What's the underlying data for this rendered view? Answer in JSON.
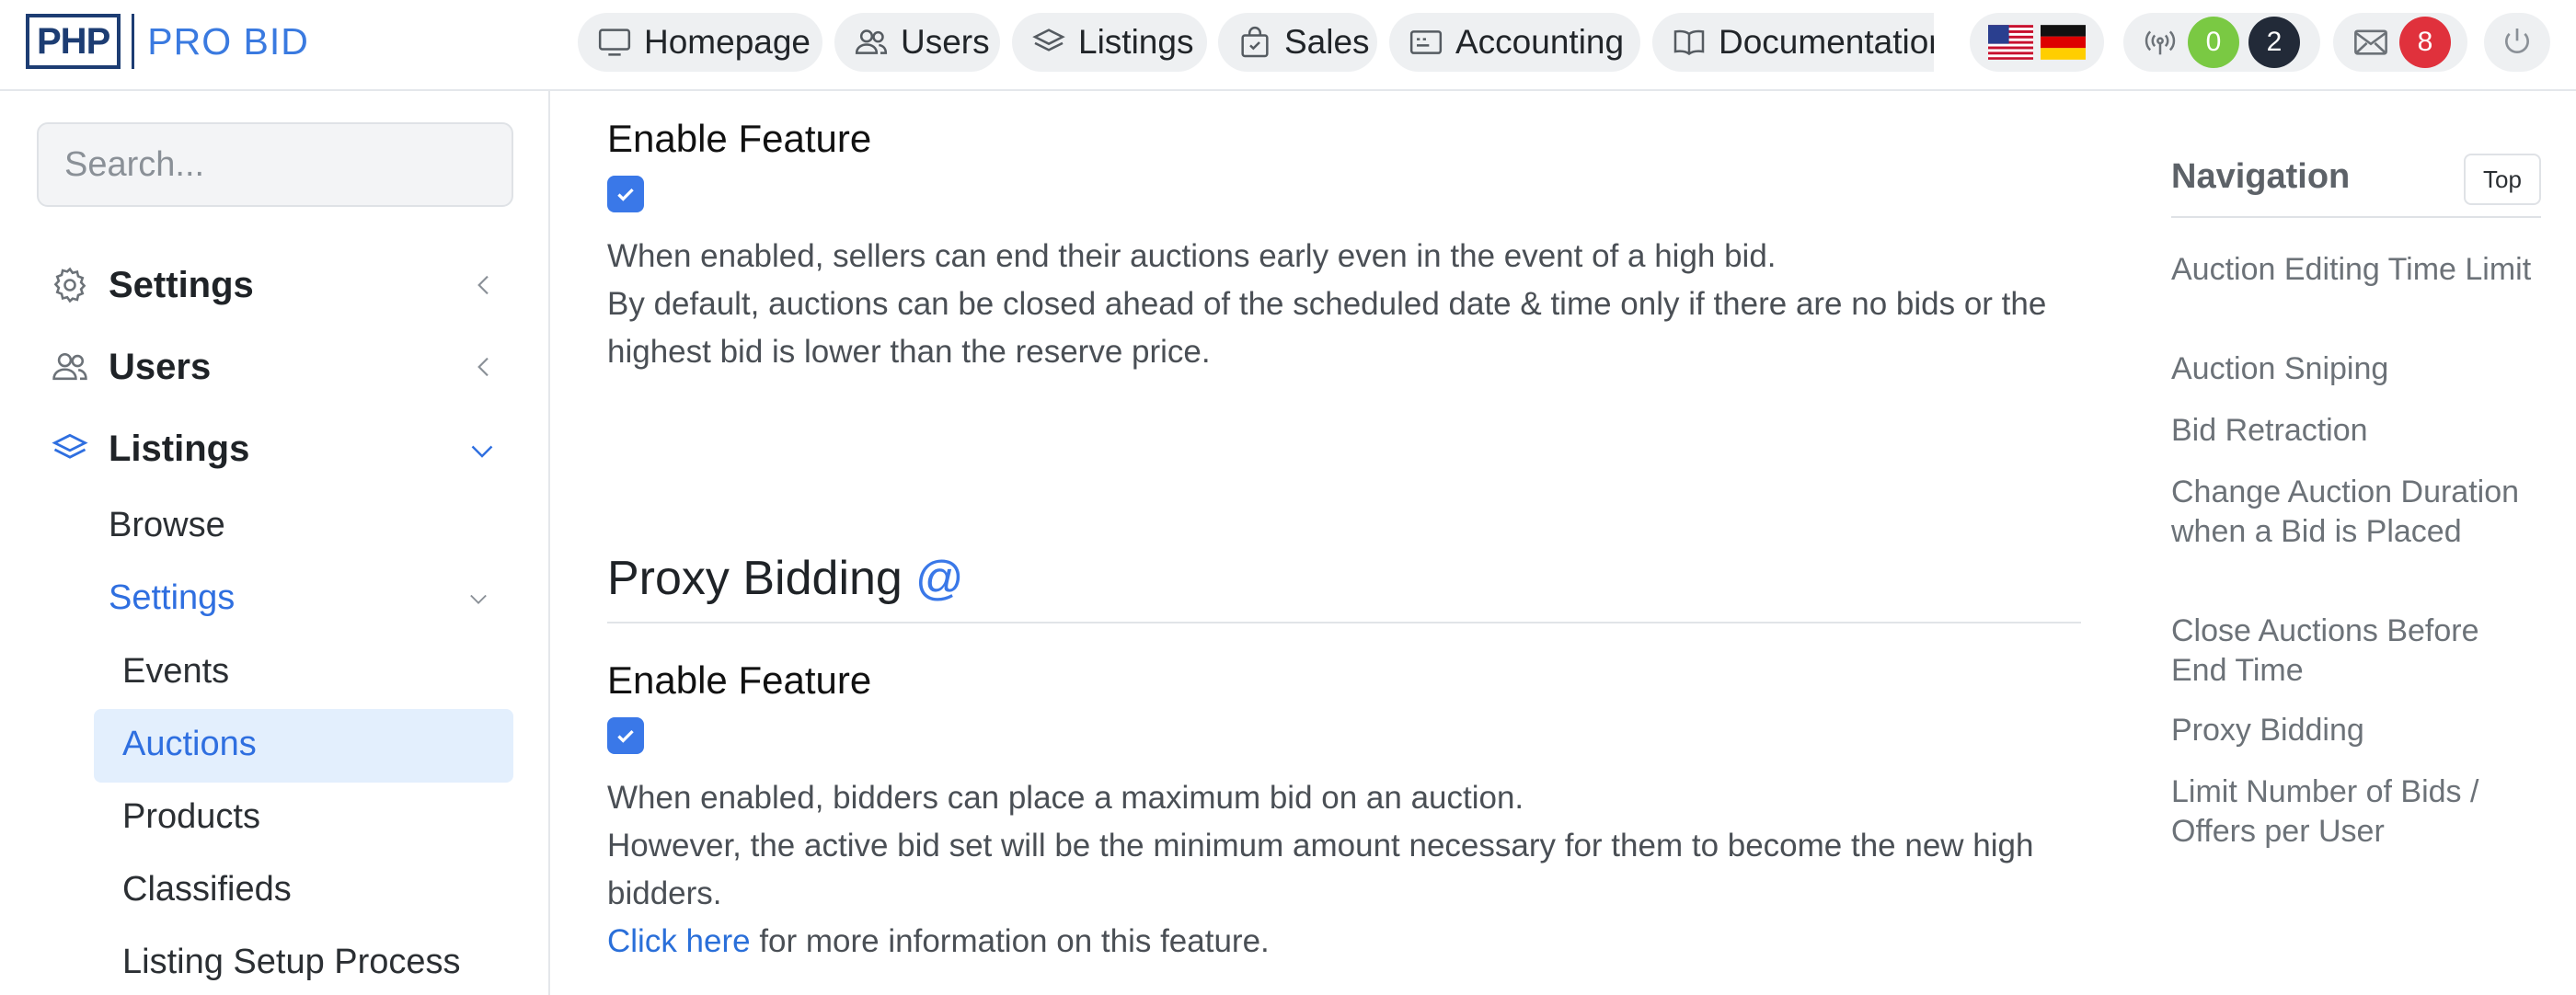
{
  "brand": {
    "logo_left": "PHP",
    "logo_right": "PRO BID"
  },
  "topnav": {
    "items": [
      {
        "label": "Homepage",
        "icon": "monitor-icon"
      },
      {
        "label": "Users",
        "icon": "users-icon"
      },
      {
        "label": "Listings",
        "icon": "layers-icon"
      },
      {
        "label": "Sales",
        "icon": "shopping-bag-icon"
      },
      {
        "label": "Accounting",
        "icon": "card-icon"
      },
      {
        "label": "Documentation",
        "icon": "book-icon"
      }
    ],
    "flags": [
      "us-flag-icon",
      "de-flag-icon"
    ],
    "notifications": {
      "green_count": "0",
      "dark_count": "2",
      "icon": "broadcast-icon"
    },
    "messages": {
      "count": "8",
      "icon": "envelope-icon"
    },
    "power_icon": "power-icon"
  },
  "sidebar": {
    "search_placeholder": "Search...",
    "items": [
      {
        "label": "Settings",
        "icon": "gear-icon",
        "expanded": false
      },
      {
        "label": "Users",
        "icon": "users-icon",
        "expanded": false
      },
      {
        "label": "Listings",
        "icon": "layers-icon",
        "expanded": true
      }
    ],
    "listings_sub": [
      "Browse",
      "Settings"
    ],
    "settings_sub": [
      "Events",
      "Auctions",
      "Products",
      "Classifieds",
      "Listing Setup Process"
    ],
    "active_item": "Auctions"
  },
  "main": {
    "close_auctions": {
      "feature_label": "Enable Feature",
      "enabled": true,
      "desc_line1": "When enabled, sellers can end their auctions early even in the event of a high bid.",
      "desc_line2": "By default, auctions can be closed ahead of the scheduled date & time only if there are no bids or the",
      "desc_line3": "highest bid is lower than the reserve price."
    },
    "proxy_bidding": {
      "heading": "Proxy Bidding",
      "anchor": "@",
      "feature_label": "Enable Feature",
      "enabled": true,
      "desc_line1": "When enabled, bidders can place a maximum bid on an auction.",
      "desc_line2": "However, the active bid set will be the minimum amount necessary for them to become the new high",
      "desc_line3": "bidders.",
      "link_text": "Click here",
      "link_suffix": " for more information on this feature."
    }
  },
  "rightnav": {
    "title": "Navigation",
    "top_button": "Top",
    "links": [
      "Auction Editing Time Limit",
      "Auction Sniping",
      "Bid Retraction",
      "Change Auction Duration when a Bid is Placed",
      "Close Auctions Before End Time",
      "Proxy Bidding",
      "Limit Number of Bids / Offers per User"
    ]
  },
  "colors": {
    "accent": "#3a78e8",
    "brand_dark": "#1d3d73",
    "badge_green": "#7ac943",
    "badge_dark": "#222a38",
    "badge_red": "#e0313c",
    "active_bg": "#e3effd"
  }
}
